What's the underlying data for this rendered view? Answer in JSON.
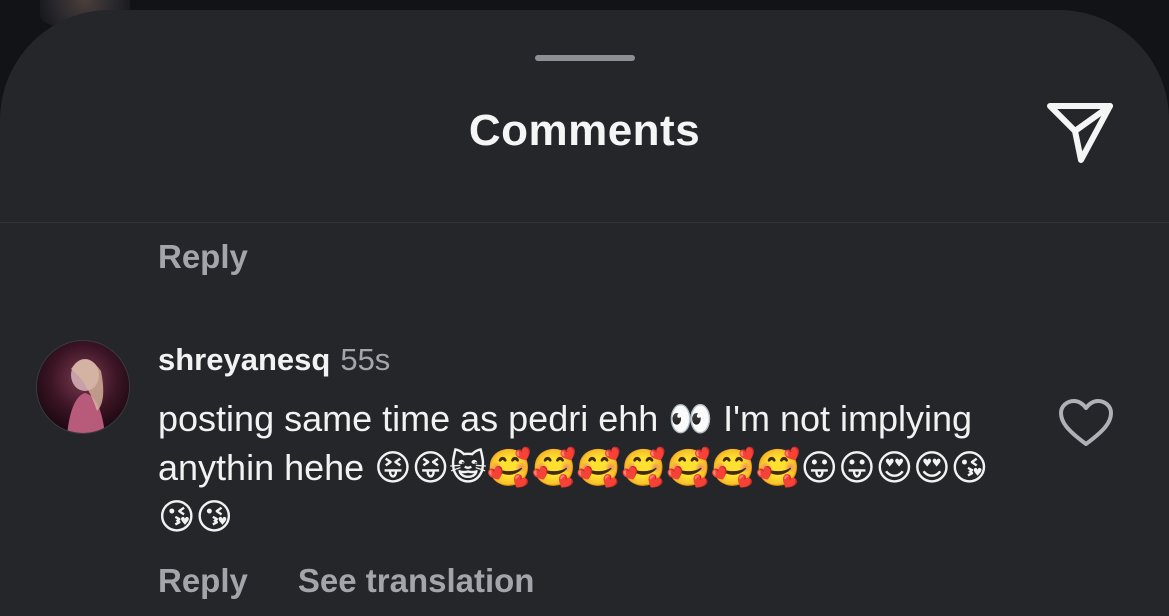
{
  "header": {
    "title": "Comments",
    "send_icon": "paper-plane-icon"
  },
  "previous_comment": {
    "reply_label": "Reply"
  },
  "comment": {
    "username": "shreyanesq",
    "timestamp": "55s",
    "text": "posting same time as pedri ehh 👀 I'm not implying anythin hehe 😝😝😺🥰🥰🥰🥰🥰🥰🥰😛😛😍😍😘😘😘",
    "like_icon": "heart-outline-icon",
    "reply_label": "Reply",
    "translate_label": "See translation"
  },
  "colors": {
    "sheet_background": "#25262a",
    "primary_text": "#f2f2f2",
    "secondary_text": "#a4a5aa"
  }
}
